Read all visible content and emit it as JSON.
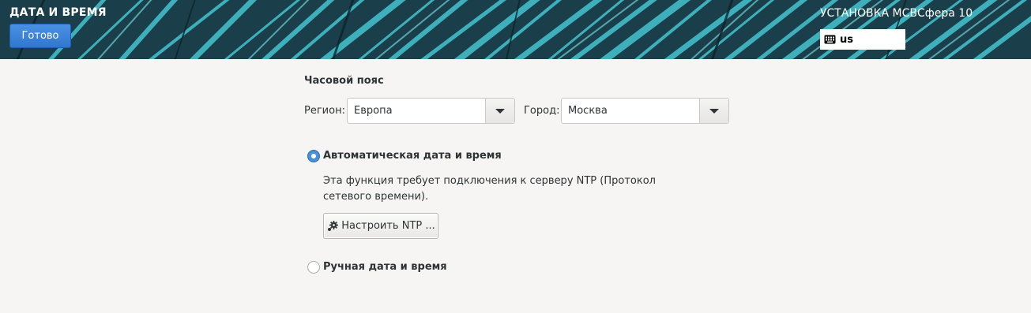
{
  "header": {
    "title": "ДАТА И ВРЕМЯ",
    "done_label": "Готово",
    "product_title": "УСТАНОВКА МСВСфера 10",
    "keyboard_layout": "us",
    "keyboard_icon": "keyboard-icon"
  },
  "timezone": {
    "heading": "Часовой пояс",
    "region_label": "Регион:",
    "region_value": "Европа",
    "city_label": "Город:",
    "city_value": "Москва"
  },
  "auto": {
    "label": "Автоматическая дата и время",
    "selected": true,
    "description": "Эта функция требует подключения к серверу NTP (Протокол сетевого времени).",
    "configure_label": "Настроить NTP ...",
    "configure_icon": "gear-icon"
  },
  "manual": {
    "label": "Ручная дата и время",
    "selected": false
  },
  "colors": {
    "accent": "#4a90d9",
    "background": "#f6f5f4",
    "header_dark": "#173a44",
    "header_teal": "#3fb7c3"
  }
}
